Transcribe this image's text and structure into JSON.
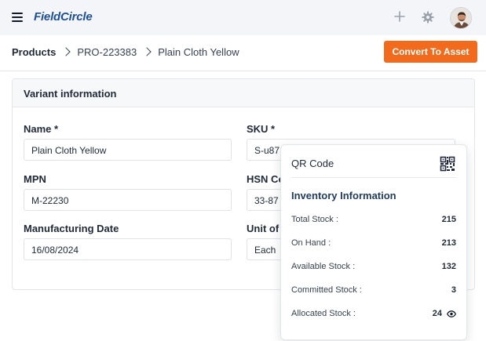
{
  "header": {
    "app_name": "FieldCircle"
  },
  "breadcrumb": {
    "root": "Products",
    "items": [
      "PRO-223383",
      "Plain Cloth Yellow"
    ]
  },
  "actions": {
    "convert_label": "Convert To Asset"
  },
  "card": {
    "title": "Variant information",
    "fields": {
      "name": {
        "label": "Name *",
        "value": "Plain Cloth Yellow"
      },
      "sku": {
        "label": "SKU *",
        "value": "S-u87"
      },
      "mpn": {
        "label": "MPN",
        "value": "M-22230"
      },
      "hsn": {
        "label": "HSN Co",
        "value": "33-87"
      },
      "mfg_date": {
        "label": "Manufacturing Date",
        "value": "16/08/2024"
      },
      "unit": {
        "label": "Unit of",
        "value": "Each"
      }
    }
  },
  "popover": {
    "qr_label": "QR Code",
    "inventory_title": "Inventory Information",
    "rows": [
      {
        "label": "Total Stock :",
        "value": "215"
      },
      {
        "label": "On Hand :",
        "value": "213"
      },
      {
        "label": "Available Stock :",
        "value": "132"
      },
      {
        "label": "Committed Stock :",
        "value": "3"
      },
      {
        "label": "Allocated Stock :",
        "value": "24"
      }
    ]
  },
  "colors": {
    "accent": "#f26b1d",
    "brand": "#1d4f9c",
    "topbar_bg": "#f3f5f8"
  },
  "icons": [
    "menu-icon",
    "plus-icon",
    "gear-icon",
    "chevron-right-icon",
    "qr-code-icon",
    "eye-icon"
  ]
}
